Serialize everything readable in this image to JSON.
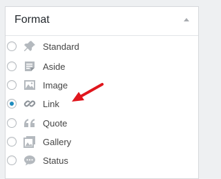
{
  "panel": {
    "title": "Format"
  },
  "formats": [
    {
      "label": "Standard",
      "icon": "pin-icon",
      "checked": false
    },
    {
      "label": "Aside",
      "icon": "aside-icon",
      "checked": false
    },
    {
      "label": "Image",
      "icon": "image-icon",
      "checked": false
    },
    {
      "label": "Link",
      "icon": "link-icon",
      "checked": true
    },
    {
      "label": "Quote",
      "icon": "quote-icon",
      "checked": false
    },
    {
      "label": "Gallery",
      "icon": "gallery-icon",
      "checked": false
    },
    {
      "label": "Status",
      "icon": "status-icon",
      "checked": false
    }
  ],
  "colors": {
    "accent": "#1e8cbe",
    "annotation_arrow": "#e0161d",
    "icon_gray": "#b4b9be"
  }
}
